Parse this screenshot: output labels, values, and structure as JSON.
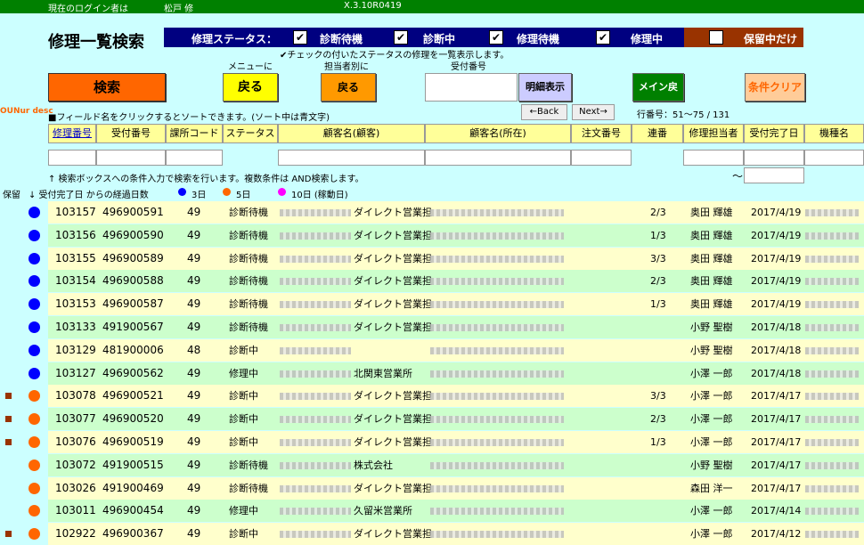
{
  "topbar": {
    "login_label": "現在のログイン者は",
    "user": "松戸 修",
    "version": "X.3.10R0419"
  },
  "title": "修理一覧検索",
  "status_filter": {
    "label": "修理ステータス：",
    "options": [
      {
        "label": "診断待機",
        "checked": true
      },
      {
        "label": "診断中",
        "checked": true
      },
      {
        "label": "修理待機",
        "checked": true
      },
      {
        "label": "修理中",
        "checked": true
      }
    ],
    "hold_label": "保留中だけ",
    "hold_checked": false
  },
  "checked_note": "✔チェックの付いたステータスの修理を一覧表示します。",
  "labels": {
    "menu_to": "メニューに",
    "by_staff": "担当者別に",
    "receipt_no": "受付番号"
  },
  "buttons": {
    "search": "検索",
    "back": "戻る",
    "staff_back": "戻る",
    "detail": "明細表示",
    "main_back": "メイン戻",
    "clear": "条件クリア",
    "prev": "←Back",
    "next": "Next→"
  },
  "logo_text": "OUNur desc",
  "sort_note": "■フィールド名をクリックするとソートできます。(ソート中は青文字)",
  "row_info": "行番号：51～75 / 131",
  "columns": [
    "修理番号",
    "受付番号",
    "課所コード",
    "ステータス",
    "顧客名(顧客)",
    "顧客名(所在)",
    "注文番号",
    "連番",
    "修理担当者",
    "受付完了日",
    "機種名"
  ],
  "search_note": "↑ 検索ボックスへの条件入力で検索を行います。複数条件は AND検索します。",
  "tilde": "～",
  "legend": {
    "hold": "保留",
    "elapsed": "↓ 受付完了日 からの経過日数",
    "d3": "3日",
    "d5": "5日",
    "d10": "10日 (稼動日)",
    "c3": "#0000ff",
    "c5": "#ff6600",
    "c10": "#ff00ff"
  },
  "rows": [
    {
      "repair": "103157",
      "receipt": "496900591",
      "code": "49",
      "status": "診断待機",
      "cust": "ダイレクト営業担",
      "seq": "2/3",
      "staff": "奥田 輝雄",
      "date": "2017/4/19",
      "dot": "blue",
      "hold": false
    },
    {
      "repair": "103156",
      "receipt": "496900590",
      "code": "49",
      "status": "診断待機",
      "cust": "ダイレクト営業担",
      "seq": "1/3",
      "staff": "奥田 輝雄",
      "date": "2017/4/19",
      "dot": "blue",
      "hold": false
    },
    {
      "repair": "103155",
      "receipt": "496900589",
      "code": "49",
      "status": "診断待機",
      "cust": "ダイレクト営業担",
      "seq": "3/3",
      "staff": "奥田 輝雄",
      "date": "2017/4/19",
      "dot": "blue",
      "hold": false
    },
    {
      "repair": "103154",
      "receipt": "496900588",
      "code": "49",
      "status": "診断待機",
      "cust": "ダイレクト営業担",
      "seq": "2/3",
      "staff": "奥田 輝雄",
      "date": "2017/4/19",
      "dot": "blue",
      "hold": false
    },
    {
      "repair": "103153",
      "receipt": "496900587",
      "code": "49",
      "status": "診断待機",
      "cust": "ダイレクト営業担",
      "seq": "1/3",
      "staff": "奥田 輝雄",
      "date": "2017/4/19",
      "dot": "blue",
      "hold": false
    },
    {
      "repair": "103133",
      "receipt": "491900567",
      "code": "49",
      "status": "診断待機",
      "cust": "ダイレクト営業担",
      "seq": "",
      "staff": "小野 聖樹",
      "date": "2017/4/18",
      "dot": "blue",
      "hold": false
    },
    {
      "repair": "103129",
      "receipt": "481900006",
      "code": "48",
      "status": "診断中",
      "cust": "",
      "seq": "",
      "staff": "小野 聖樹",
      "date": "2017/4/18",
      "dot": "blue",
      "hold": false
    },
    {
      "repair": "103127",
      "receipt": "496900562",
      "code": "49",
      "status": "修理中",
      "cust": "北関東営業所",
      "seq": "",
      "staff": "小澤 一郎",
      "date": "2017/4/18",
      "dot": "blue",
      "hold": false
    },
    {
      "repair": "103078",
      "receipt": "496900521",
      "code": "49",
      "status": "診断中",
      "cust": "ダイレクト営業担",
      "seq": "3/3",
      "staff": "小澤 一郎",
      "date": "2017/4/17",
      "dot": "orange",
      "hold": true
    },
    {
      "repair": "103077",
      "receipt": "496900520",
      "code": "49",
      "status": "診断中",
      "cust": "ダイレクト営業担",
      "seq": "2/3",
      "staff": "小澤 一郎",
      "date": "2017/4/17",
      "dot": "orange",
      "hold": true
    },
    {
      "repair": "103076",
      "receipt": "496900519",
      "code": "49",
      "status": "診断中",
      "cust": "ダイレクト営業担",
      "seq": "1/3",
      "staff": "小澤 一郎",
      "date": "2017/4/17",
      "dot": "orange",
      "hold": true
    },
    {
      "repair": "103072",
      "receipt": "491900515",
      "code": "49",
      "status": "診断待機",
      "cust": "株式会社",
      "seq": "",
      "staff": "小野 聖樹",
      "date": "2017/4/17",
      "dot": "orange",
      "hold": false
    },
    {
      "repair": "103026",
      "receipt": "491900469",
      "code": "49",
      "status": "診断待機",
      "cust": "ダイレクト営業担",
      "seq": "",
      "staff": "森田 洋一",
      "date": "2017/4/17",
      "dot": "orange",
      "hold": false
    },
    {
      "repair": "103011",
      "receipt": "496900454",
      "code": "49",
      "status": "修理中",
      "cust": "久留米営業所",
      "seq": "",
      "staff": "小澤 一郎",
      "date": "2017/4/14",
      "dot": "orange",
      "hold": false
    },
    {
      "repair": "102922",
      "receipt": "496900367",
      "code": "49",
      "status": "診断中",
      "cust": "ダイレクト営業担",
      "seq": "",
      "staff": "小澤 一郎",
      "date": "2017/4/12",
      "dot": "orange",
      "hold": true
    }
  ]
}
